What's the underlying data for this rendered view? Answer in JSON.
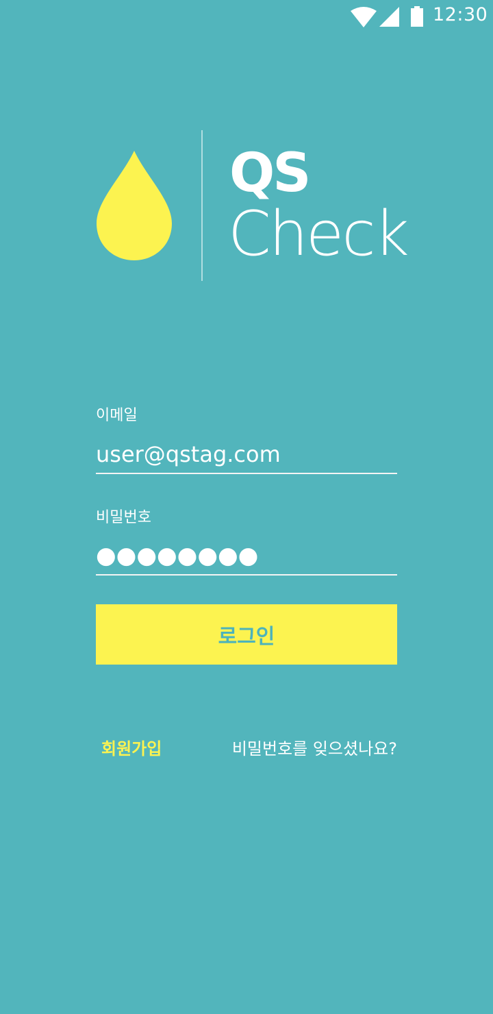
{
  "status_bar": {
    "time": "12:30",
    "icons": [
      "wifi-icon",
      "signal-icon",
      "battery-icon"
    ]
  },
  "logo": {
    "line1": "QS",
    "line2": "Check",
    "icon": "water-drop-icon"
  },
  "form": {
    "email_label": "이메일",
    "email_value": "user@qstag.com",
    "password_label": "비밀번호",
    "password_value": "●●●●●●●●",
    "login_label": "로그인"
  },
  "links": {
    "signup": "회원가입",
    "forgot_password": "비밀번호를 잊으셨나요?"
  },
  "colors": {
    "background": "#52b5bc",
    "accent_yellow": "#fcf350",
    "button_text": "#4db3bb",
    "text_white": "#ffffff"
  }
}
